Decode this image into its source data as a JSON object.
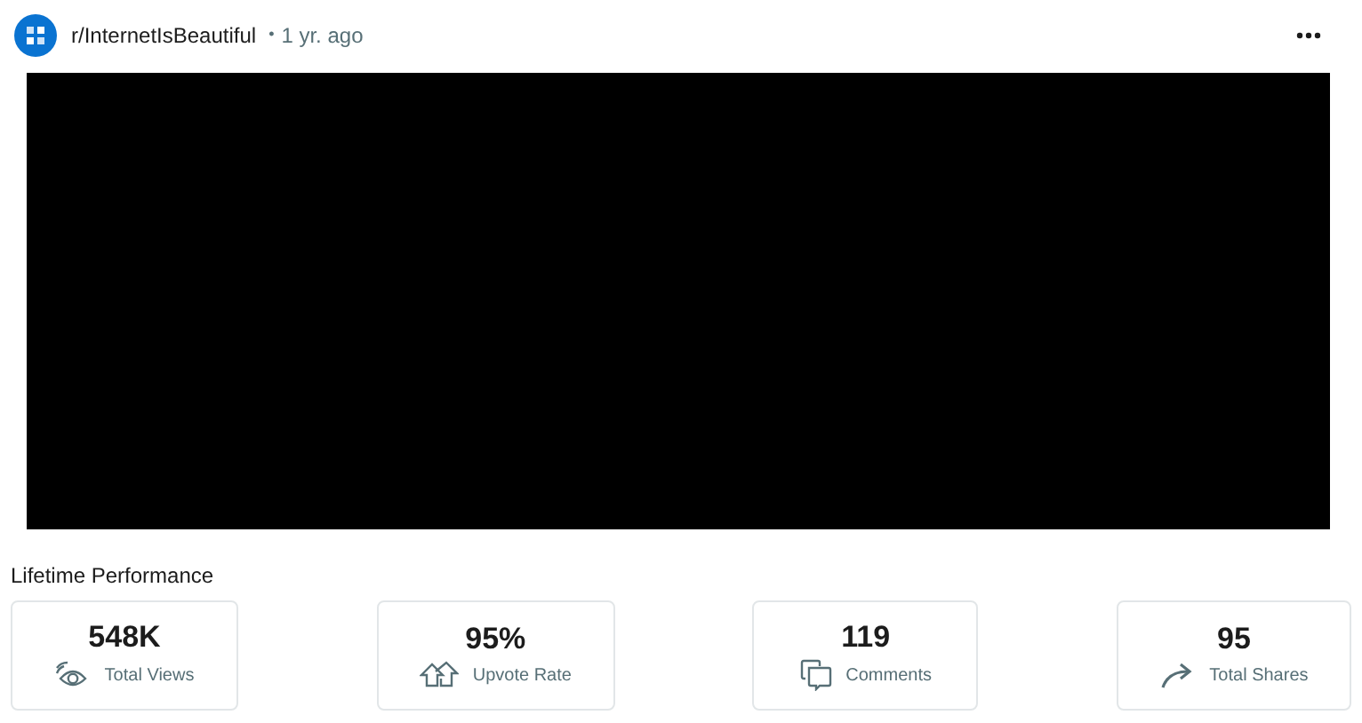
{
  "post": {
    "community": "r/InternetIsBeautiful",
    "separator": "•",
    "age": "1 yr. ago"
  },
  "performance": {
    "title": "Lifetime Performance",
    "stats": [
      {
        "kind": "views",
        "value": "548K",
        "label": "Total Views"
      },
      {
        "kind": "upvote",
        "value": "95%",
        "label": "Upvote Rate"
      },
      {
        "kind": "comments",
        "value": "119",
        "label": "Comments"
      },
      {
        "kind": "shares",
        "value": "95",
        "label": "Total Shares"
      }
    ]
  }
}
